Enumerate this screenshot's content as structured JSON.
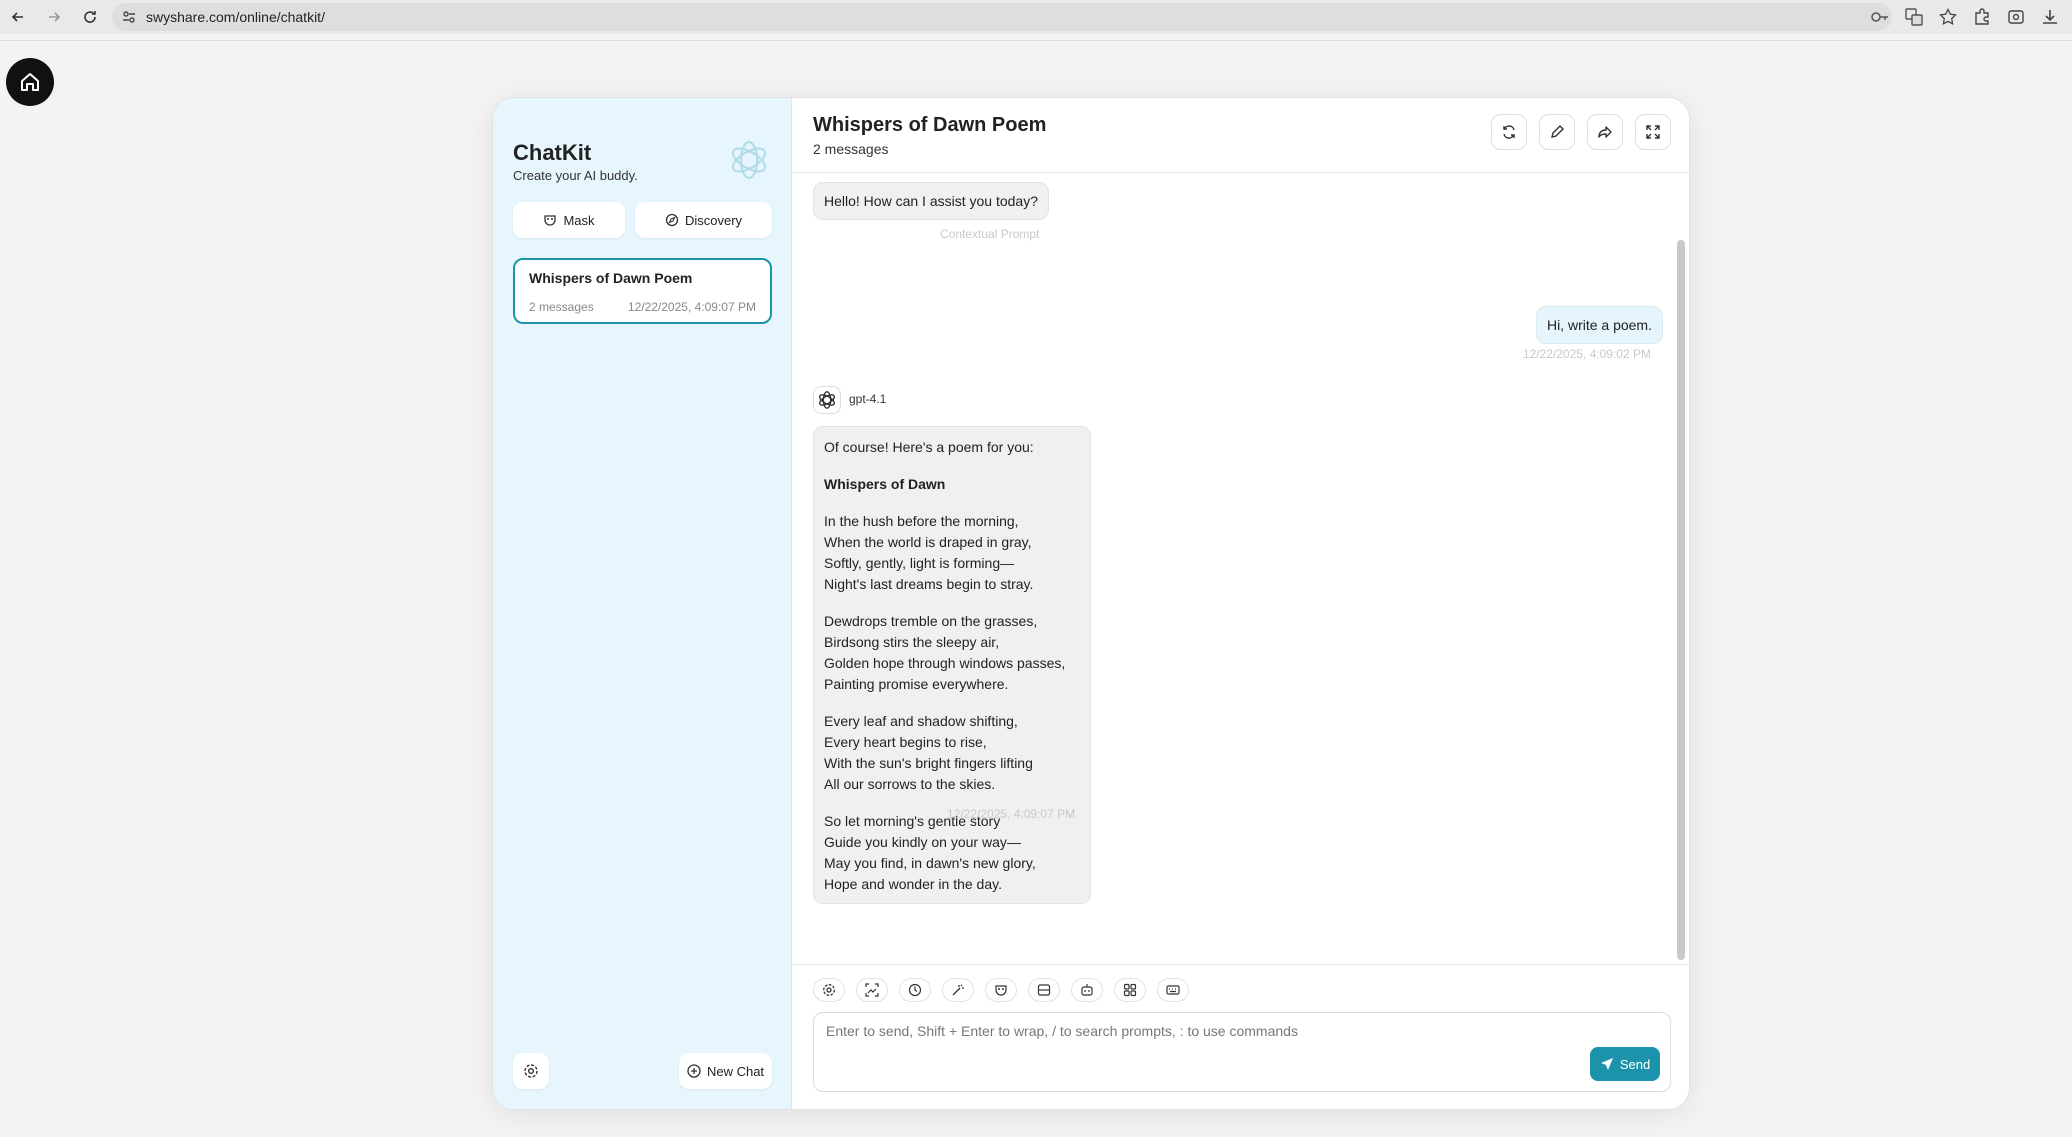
{
  "browser": {
    "url": "swyshare.com/online/chatkit/"
  },
  "sidebar": {
    "title": "ChatKit",
    "subtitle": "Create your AI buddy.",
    "mask_label": "Mask",
    "discovery_label": "Discovery",
    "chats": [
      {
        "title": "Whispers of Dawn Poem",
        "count": "2 messages",
        "time": "12/22/2025, 4:09:07 PM"
      }
    ],
    "new_chat_label": "New Chat"
  },
  "chat": {
    "title": "Whispers of Dawn Poem",
    "count": "2 messages",
    "messages": [
      {
        "role": "system",
        "text": "Hello! How can I assist you today?",
        "note": "Contextual Prompt"
      },
      {
        "role": "user",
        "text": "Hi, write a poem.",
        "time": "12/22/2025, 4:09:02 PM"
      },
      {
        "role": "assistant",
        "model": "gpt-4.1",
        "intro": "Of course! Here's a poem for you:",
        "poem_title": "Whispers of Dawn",
        "stanzas": [
          [
            "In the hush before the morning,",
            "When the world is draped in gray,",
            "Softly, gently, light is forming—",
            "Night's last dreams begin to stray."
          ],
          [
            "Dewdrops tremble on the grasses,",
            "Birdsong stirs the sleepy air,",
            "Golden hope through windows passes,",
            "Painting promise everywhere."
          ],
          [
            "Every leaf and shadow shifting,",
            "Every heart begins to rise,",
            "With the sun's bright fingers lifting",
            "All our sorrows to the skies."
          ],
          [
            "So let morning's gentle story",
            "Guide you kindly on your way—",
            "May you find, in dawn's new glory,",
            "Hope and wonder in the day."
          ]
        ],
        "time": "12/22/2025, 4:09:07 PM"
      }
    ],
    "emoji": "😃"
  },
  "composer": {
    "placeholder": "Enter to send, Shift + Enter to wrap, / to search prompts, : to use commands",
    "send_label": "Send"
  },
  "colors": {
    "accent": "#1d93ab",
    "sidebar_bg": "#e7f6fd"
  }
}
